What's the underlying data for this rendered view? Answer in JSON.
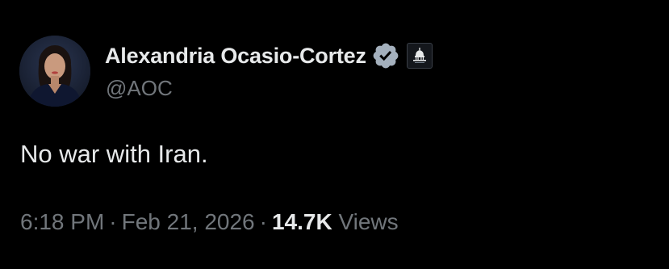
{
  "author": {
    "display_name": "Alexandria Ocasio-Cortez",
    "handle": "@AOC",
    "verified_icon": "verified-badge-icon",
    "affiliation_icon": "capitol-building-icon"
  },
  "tweet": {
    "text": "No war with Iran.",
    "time": "6:18 PM",
    "separator": "·",
    "date": "Feb 21, 2026",
    "views_count": "14.7K",
    "views_label": "Views"
  },
  "colors": {
    "background": "#000000",
    "primary_text": "#e7e9ea",
    "secondary_text": "#71767b",
    "verified_badge": "#a4b0bd"
  }
}
